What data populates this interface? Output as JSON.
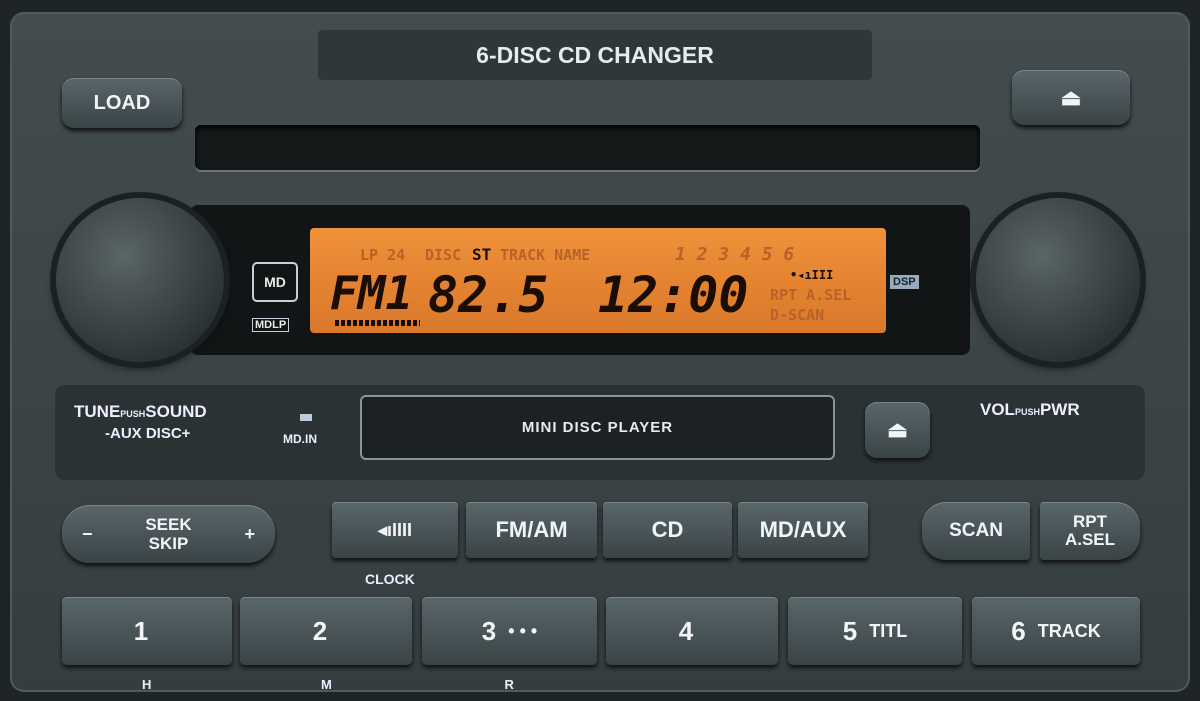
{
  "header": {
    "title": "6-DISC CD CHANGER"
  },
  "buttons": {
    "load": "LOAD",
    "eject_icon": "eject-icon",
    "seek_minus": "−",
    "seek_label_1": "SEEK",
    "seek_label_2": "SKIP",
    "seek_plus": "+",
    "sound": "◂ıIIII",
    "fm_am": "FM/AM",
    "cd": "CD",
    "md_aux": "MD/AUX",
    "scan": "SCAN",
    "rpt_1": "RPT",
    "rpt_2": "A.SEL"
  },
  "labels": {
    "tune_1": "TUNE",
    "tune_push": "PUSH",
    "tune_2": "SOUND",
    "aux_disc": "-AUX DISC+",
    "md_in": "MD.IN",
    "mini_disc": "MINI DISC PLAYER",
    "vol": "VOL",
    "vol_push": "PUSH",
    "pwr": "PWR",
    "clock": "CLOCK",
    "md_logo": "MD",
    "mdlp": "MDLP",
    "dsp": "DSP"
  },
  "display": {
    "lp": "LP 24",
    "disc": "DISC",
    "st": "ST",
    "track_name": "TRACK NAME",
    "disc_numbers": "1 2 3 4 5 6",
    "band": "FM1",
    "frequency": "82.5",
    "clock": "12:00",
    "rpt": "RPT A.SEL",
    "dscan": "D-SCAN",
    "signal": "•◂ıIII"
  },
  "presets": [
    {
      "num": "1",
      "sub": "",
      "under": "H"
    },
    {
      "num": "2",
      "sub": "",
      "under": "M"
    },
    {
      "num": "3",
      "sub": "• • •",
      "under": "R"
    },
    {
      "num": "4",
      "sub": "",
      "under": ""
    },
    {
      "num": "5",
      "sub": "TITL",
      "under": ""
    },
    {
      "num": "6",
      "sub": "TRACK",
      "under": ""
    }
  ],
  "colors": {
    "lcd": "#e8872e",
    "panel": "#3a4244"
  }
}
